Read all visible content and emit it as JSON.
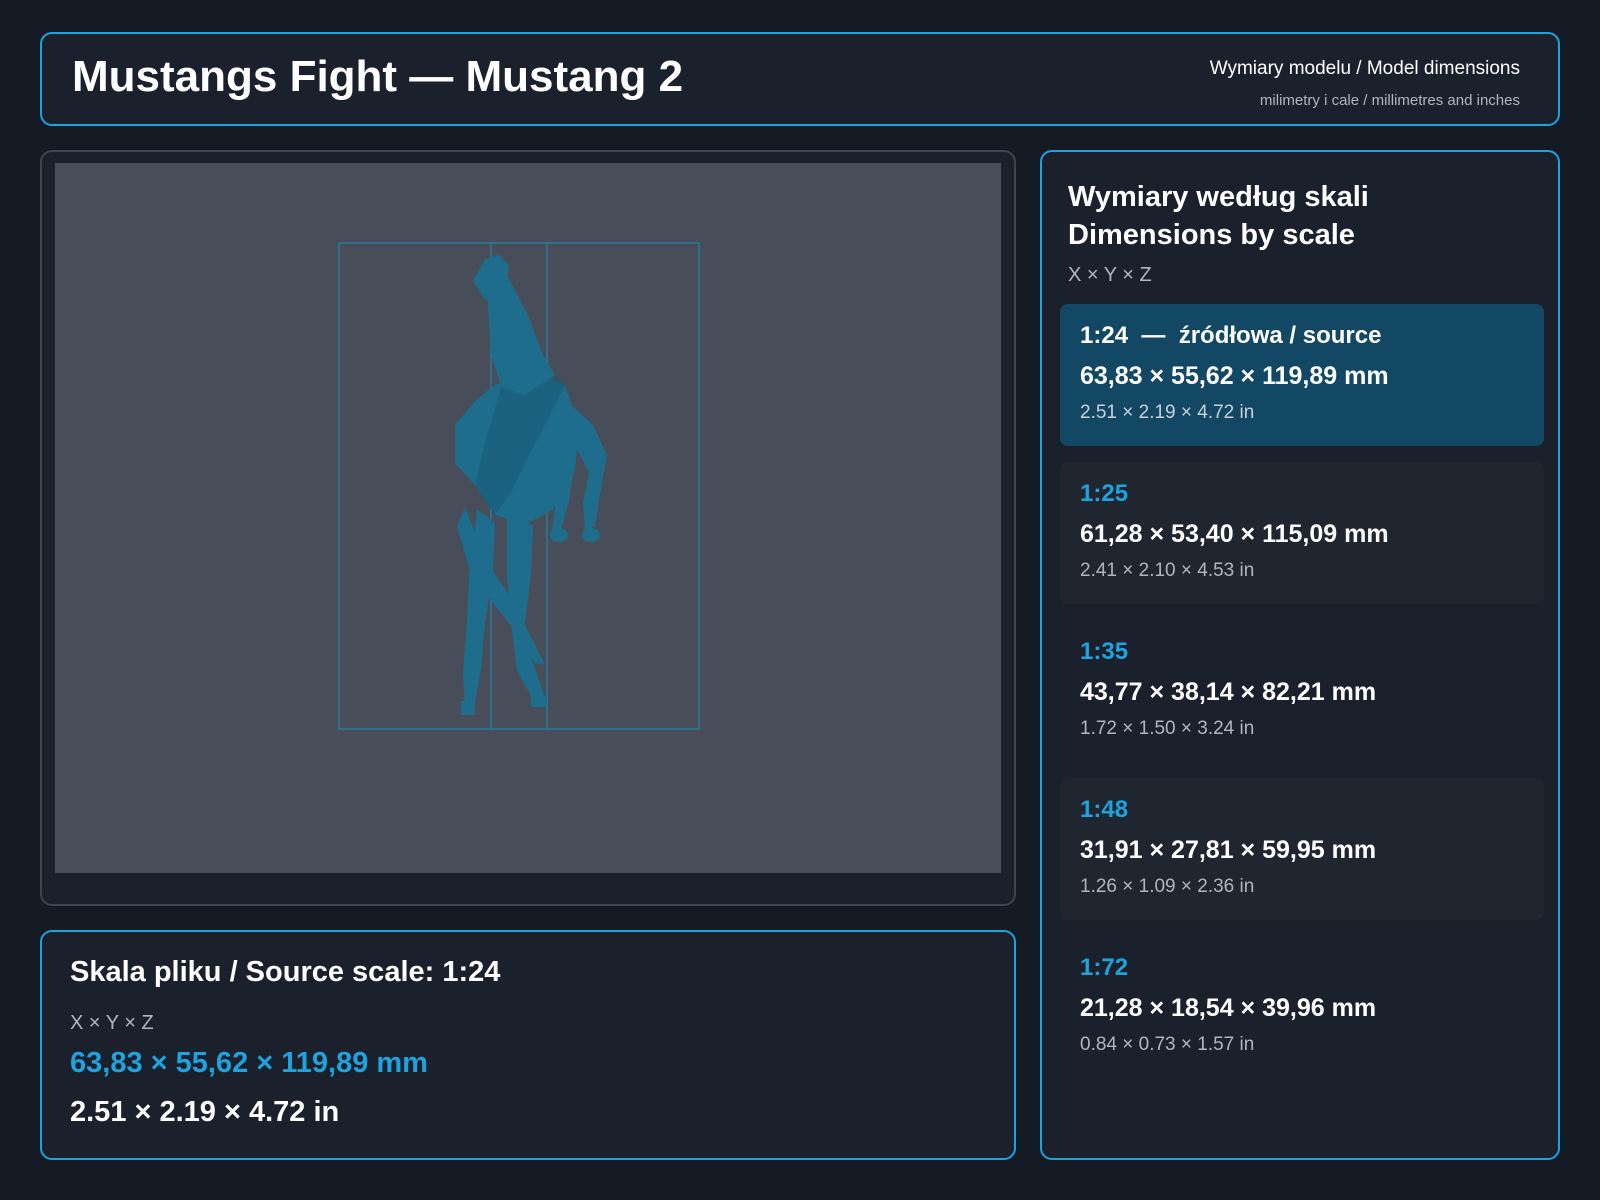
{
  "header": {
    "title": "Mustangs Fight — Mustang 2",
    "subtitle": "Wymiary modelu / Model dimensions",
    "units_note": "milimetry i cale / millimetres and inches"
  },
  "source": {
    "title": "Skala pliku / Source scale: 1:24",
    "axes": "X × Y × Z",
    "mm": "63,83 × 55,62 × 119,89 mm",
    "inches": "2.51 × 2.19 × 4.72 in"
  },
  "scales_panel": {
    "title_pl": "Wymiary według skali",
    "title_en": "Dimensions by scale",
    "axes": "X × Y × Z",
    "items": [
      {
        "label": "1:24  —  źródłowa / source",
        "mm": "63,83 × 55,62 × 119,89 mm",
        "inches": "2.51 × 2.19 × 4.72 in",
        "selected": true
      },
      {
        "label": "1:25",
        "mm": "61,28 × 53,40 × 115,09 mm",
        "inches": "2.41 × 2.10 × 4.53 in",
        "selected": false
      },
      {
        "label": "1:35",
        "mm": "43,77 × 38,14 × 82,21 mm",
        "inches": "1.72 × 1.50 × 3.24 in",
        "selected": false
      },
      {
        "label": "1:48",
        "mm": "31,91 × 27,81 × 59,95 mm",
        "inches": "1.26 × 1.09 × 2.36 in",
        "selected": false
      },
      {
        "label": "1:72",
        "mm": "21,28 × 18,54 × 39,96 mm",
        "inches": "0.84 × 0.73 × 1.57 in",
        "selected": false
      }
    ]
  },
  "colors": {
    "accent": "#1fa3de",
    "background": "#141b24",
    "panel": "#1a212c",
    "selected": "#124864",
    "model": "#1e6d8c"
  }
}
